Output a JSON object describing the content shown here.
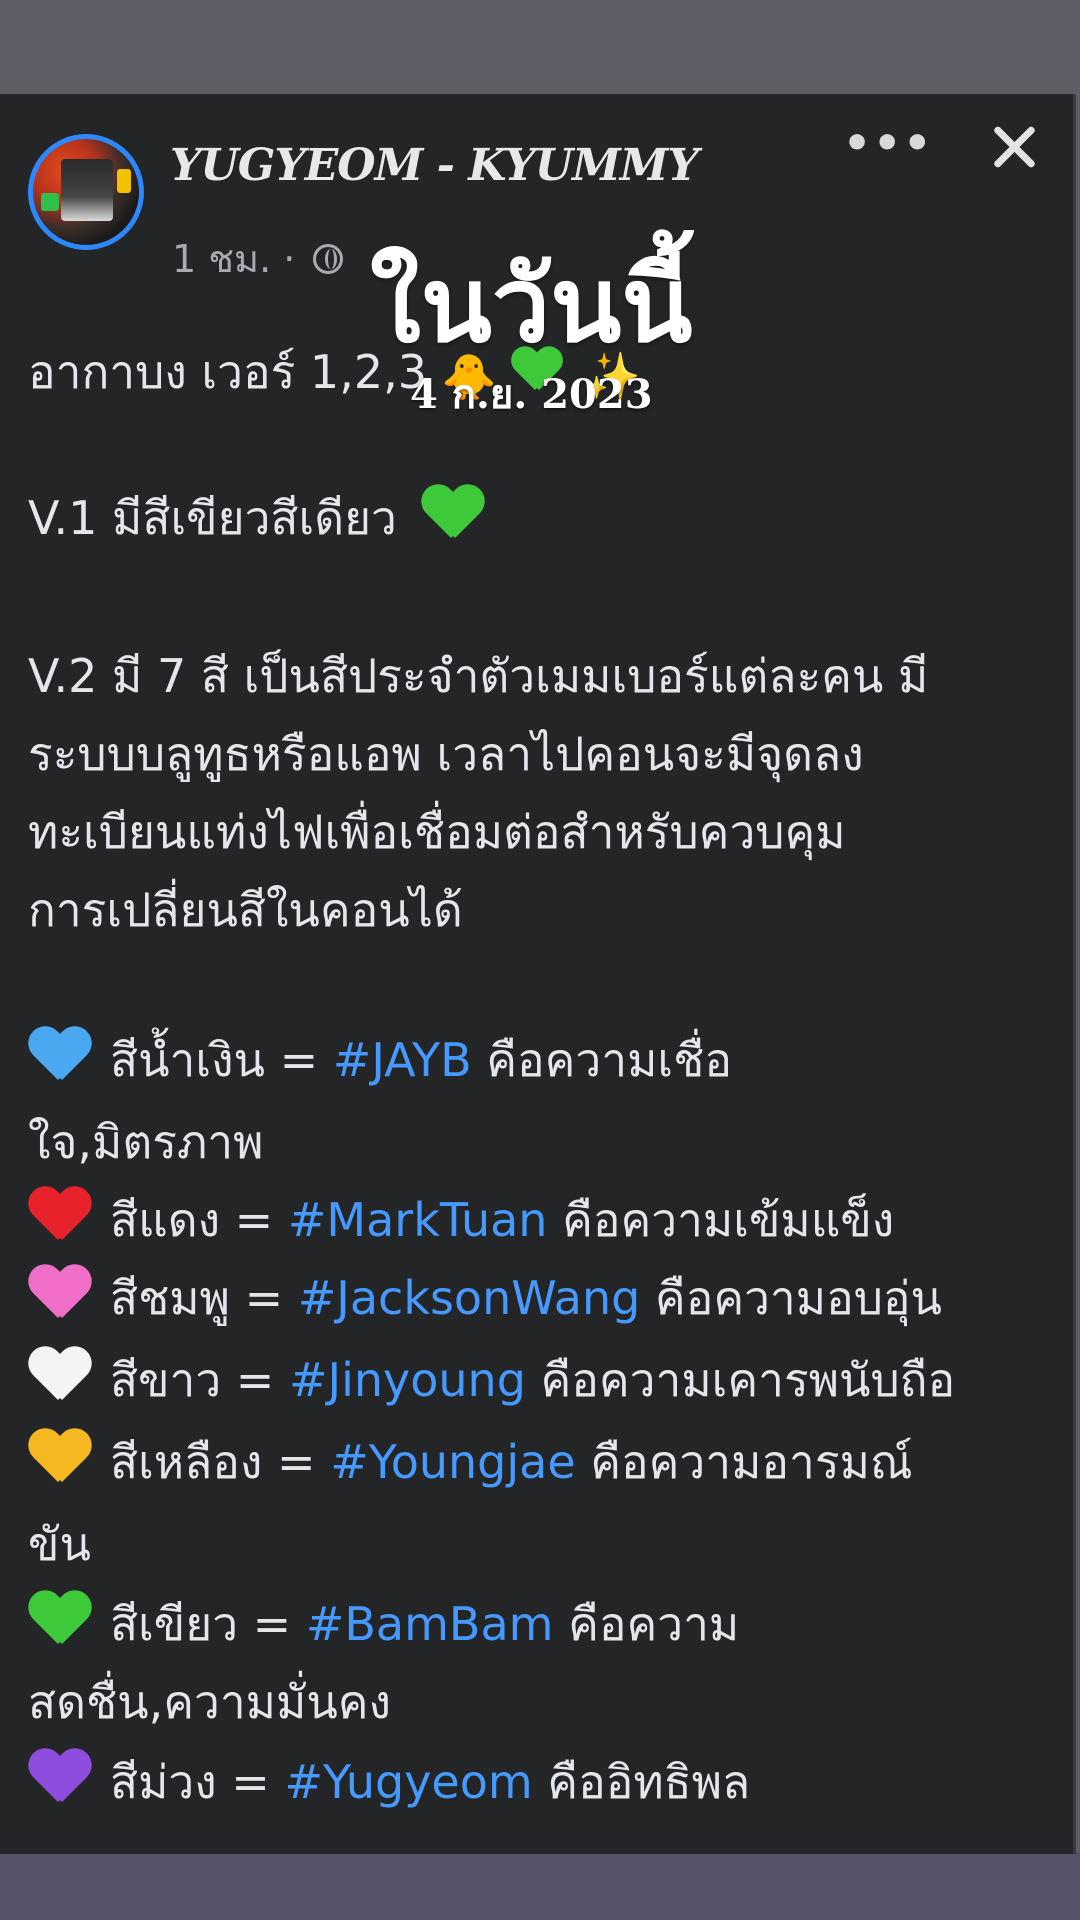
{
  "post": {
    "author": "YUGYEOM - KYUMMY",
    "time": "1 ชม. ·",
    "overlay_title": "ในวันนี้",
    "overlay_date": "4 ก.ย. 2023"
  },
  "body": {
    "intro": "อากาบง เวอร์ 1,2,3",
    "v1": "V.1 มีสีเขียวสีเดียว",
    "v2_lines": [
      "V.2 มี 7 สี เป็นสีประจำตัวเมมเบอร์แต่ละคน มี",
      "ระบบบลูทูธหรือแอพ เวลาไปคอนจะมีจุดลง",
      "ทะเบียนแท่งไฟเพื่อเชื่อมต่อสำหรับควบคุม",
      "การเปลี่ยนสีในคอนได้"
    ],
    "colors": [
      {
        "icon": "blue-heart-icon",
        "color": "#4aa8f0",
        "label": "สีน้ำเงิน = ",
        "tag": "#JAYB",
        "meaning": " คือความเชื่อ",
        "cont": "ใจ,มิตรภาพ"
      },
      {
        "icon": "red-heart-icon",
        "color": "#e7222a",
        "label": "สีแดง = ",
        "tag": "#MarkTuan",
        "meaning": " คือความเข้มแข็ง"
      },
      {
        "icon": "pink-heart-icon",
        "color": "#f06ec8",
        "label": "สีชมพู = ",
        "tag": "#JacksonWang",
        "meaning": " คือความอบอุ่น"
      },
      {
        "icon": "white-heart-icon",
        "color": "#f4f4f4",
        "label": "สีขาว = ",
        "tag": "#Jinyoung",
        "meaning": " คือความเคารพนับถือ"
      },
      {
        "icon": "yellow-heart-icon",
        "color": "#f5b820",
        "label": "สีเหลือง = ",
        "tag": "#Youngjae",
        "meaning": " คือความอารมณ์",
        "cont": "ขัน"
      },
      {
        "icon": "green-heart-icon",
        "color": "#3ec93a",
        "label": "สีเขียว = ",
        "tag": "#BamBam",
        "meaning": " คือความ",
        "cont": "สดชื่น,ความมั่นคง"
      },
      {
        "icon": "purple-heart-icon",
        "color": "#8f4de0",
        "label": "สีม่วง = ",
        "tag": "#Yugyeom",
        "meaning": " คืออิทธิพล"
      }
    ]
  },
  "icons": {
    "chick": "🐥",
    "sparkles": "✨"
  }
}
